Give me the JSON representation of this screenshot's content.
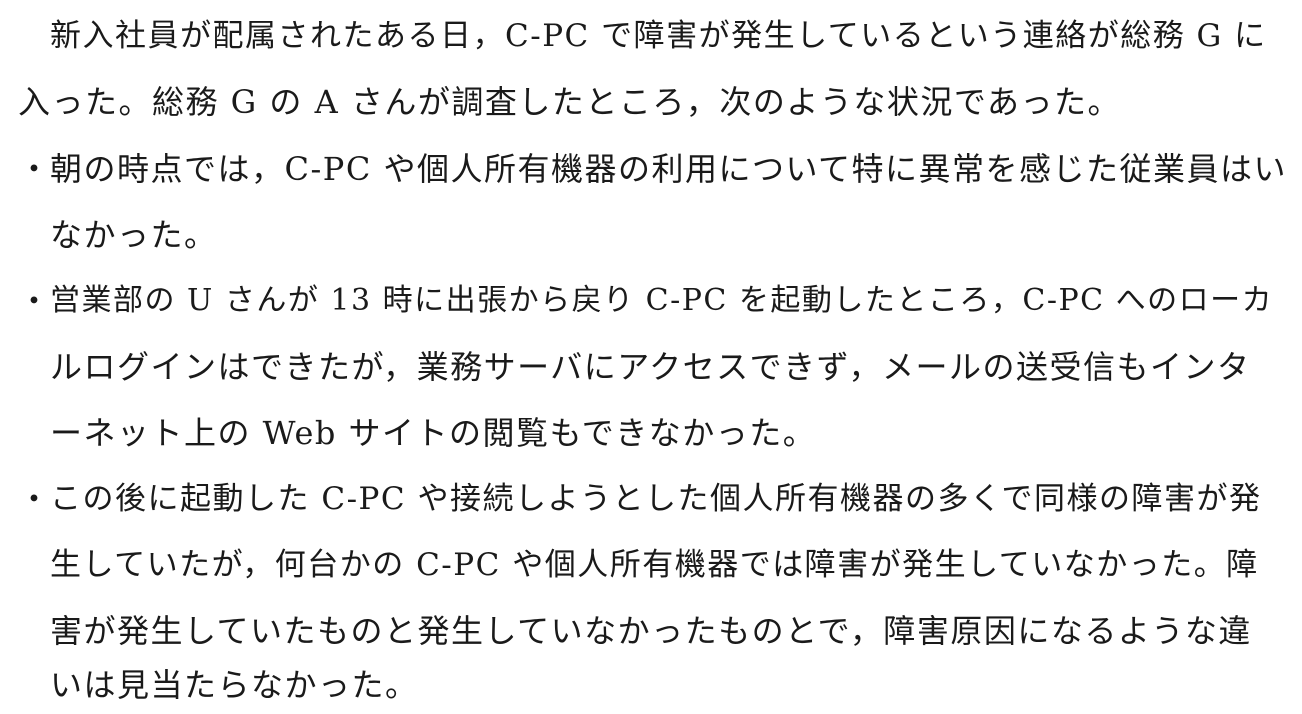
{
  "intro": {
    "line1": "新入社員が配属されたある日，C-PC で障害が発生しているという連絡が総務 G に",
    "line2": "入った。総務 G の A さんが調査したところ，次のような状況であった。"
  },
  "bullets": [
    {
      "mark": "・",
      "lines": [
        "朝の時点では，C-PC や個人所有機器の利用について特に異常を感じた従業員はい",
        "なかった。"
      ]
    },
    {
      "mark": "・",
      "lines": [
        "営業部の U さんが 13 時に出張から戻り C-PC を起動したところ，C-PC へのローカ",
        "ルログインはできたが，業務サーバにアクセスできず，メールの送受信もインタ",
        "ーネット上の Web サイトの閲覧もできなかった。"
      ]
    },
    {
      "mark": "・",
      "lines": [
        "この後に起動した C-PC や接続しようとした個人所有機器の多くで同様の障害が発",
        "生していたが，何台かの C-PC や個人所有機器では障害が発生していなかった。障",
        "害が発生していたものと発生していなかったものとで，障害原因になるような違",
        "いは見当たらなかった。"
      ]
    }
  ]
}
